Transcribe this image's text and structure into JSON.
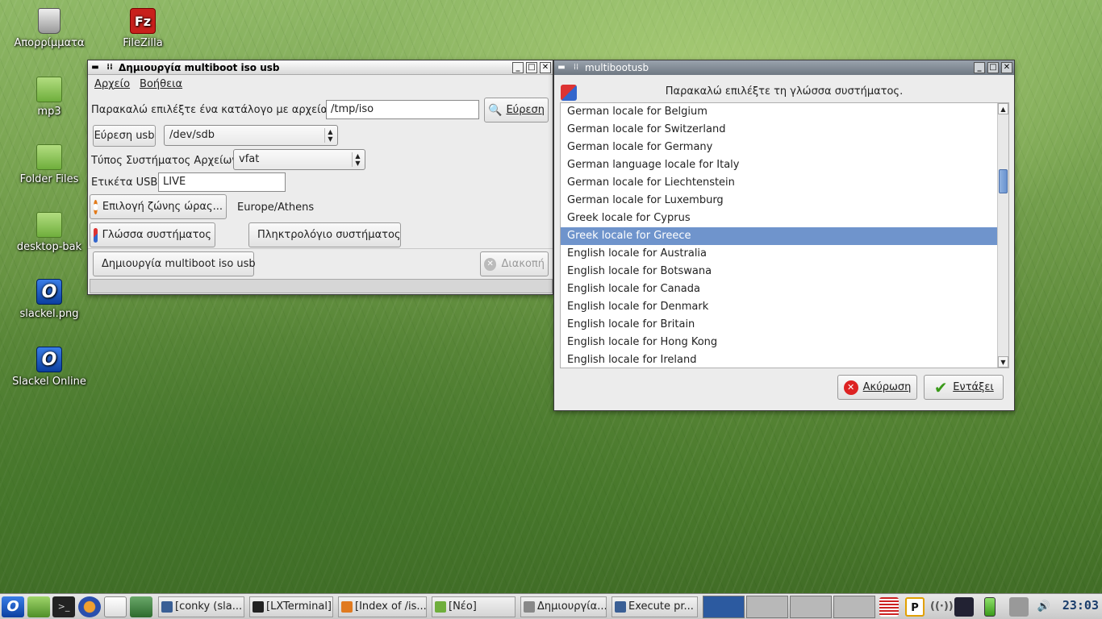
{
  "desktop": {
    "icons": [
      {
        "label": "Απορρίμματα"
      },
      {
        "label": "FileZilla"
      },
      {
        "label": "mp3"
      },
      {
        "label": "Folder Files"
      },
      {
        "label": "desktop-bak"
      },
      {
        "label": "slackel.png"
      },
      {
        "label": "Slackel Online"
      }
    ]
  },
  "main_window": {
    "title": "Δημιουργία multiboot iso usb",
    "menu": [
      "Αρχείο",
      "Βοήθεια"
    ],
    "iso_label": "Παρακαλώ επιλέξτε ένα κατάλογο με αρχεία iso.",
    "iso_path": "/tmp/iso",
    "browse_button": "Εύρεση",
    "find_usb_button": "Εύρεση usb",
    "usb_device": "/dev/sdb",
    "fs_label": "Τύπος Συστήματος Αρχείων:",
    "fs_value": "vfat",
    "usb_label_label": "Ετικέτα USB:",
    "usb_label_value": "LIVE",
    "timezone_button": "Επιλογή ζώνης ώρας...",
    "timezone_value": "Europe/Athens",
    "language_button": "Γλώσσα συστήματος",
    "keyboard_button": "Πληκτρολόγιο συστήματος",
    "create_button": "Δημιουργία multiboot iso usb",
    "stop_button": "Διακοπή"
  },
  "lang_window": {
    "title": "multibootusb",
    "prompt": "Παρακαλώ επιλέξτε τη γλώσσα συστήματος.",
    "locales": [
      "German locale for Belgium",
      "German locale for Switzerland",
      "German locale for Germany",
      "German language locale for Italy",
      "German locale for Liechtenstein",
      "German locale for Luxemburg",
      "Greek locale for Cyprus",
      "Greek locale for Greece",
      "English locale for Australia",
      "English locale for Botswana",
      "English locale for Canada",
      "English locale for Denmark",
      "English locale for Britain",
      "English locale for Hong Kong",
      "English locale for Ireland"
    ],
    "selected_index": 7,
    "scroll_position": 0.25,
    "cancel_button": "Ακύρωση",
    "ok_button": "Εντάξει"
  },
  "taskbar": {
    "tasks": [
      {
        "label": "[conky (sla..."
      },
      {
        "label": "[LXTerminal]"
      },
      {
        "label": "[Index of /is..."
      },
      {
        "label": "[Νέο]"
      },
      {
        "label": "Δημιουργία..."
      },
      {
        "label": "Execute pr..."
      }
    ],
    "clock": "23:03"
  },
  "colors": {
    "selection": "#6f94cc",
    "clock": "#1a3d6c"
  }
}
